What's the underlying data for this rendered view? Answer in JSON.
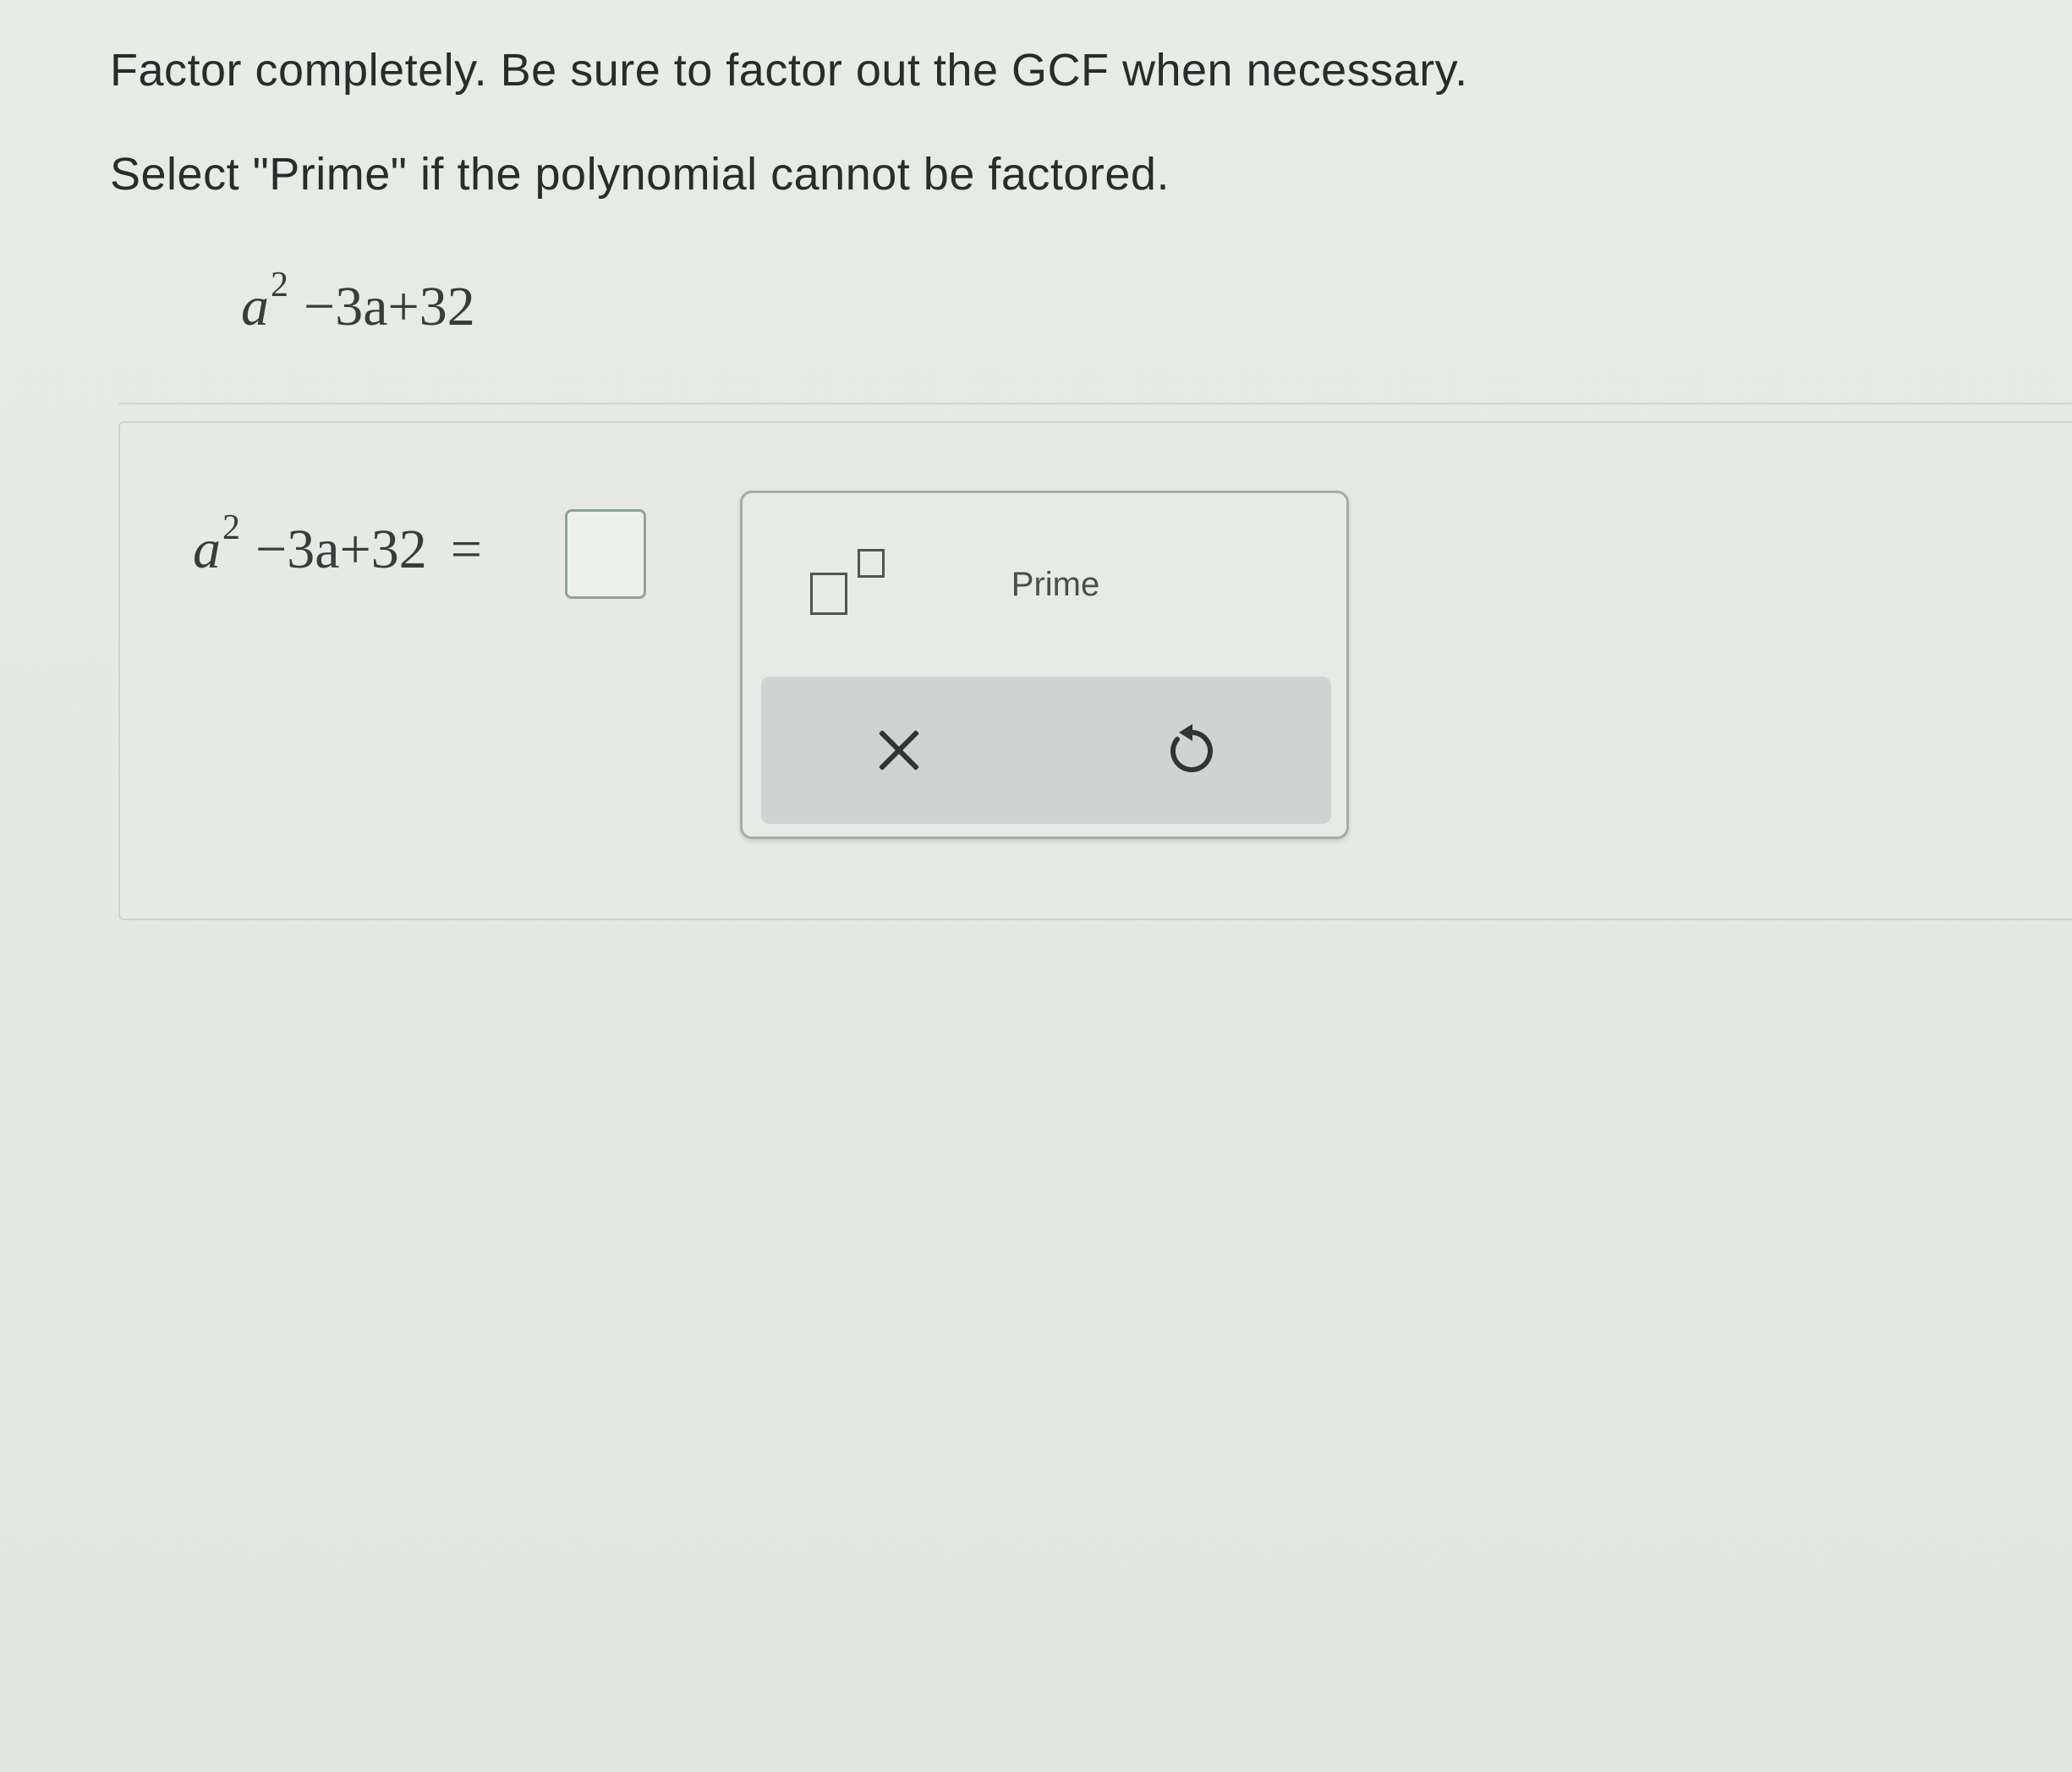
{
  "instructions": {
    "line1": "Factor completely. Be sure to factor out the GCF when necessary.",
    "line2": "Select \"Prime\" if the polynomial cannot be factored."
  },
  "problem": {
    "base": "a",
    "exponent": "2",
    "rest": "−3a+32"
  },
  "answer": {
    "base": "a",
    "exponent": "2",
    "rest": "−3a+32",
    "equals": "=",
    "value": ""
  },
  "keypad": {
    "exponent_icon": "superscript-template-icon",
    "prime_label": "Prime",
    "clear_icon": "close-x-icon",
    "undo_icon": "undo-icon"
  }
}
